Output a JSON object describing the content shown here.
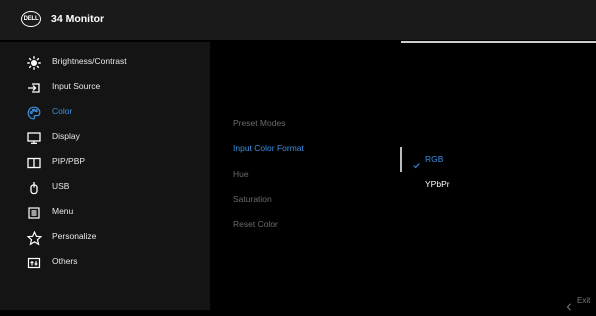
{
  "header": {
    "logo_text": "DELL",
    "title": "34 Monitor"
  },
  "menu": {
    "items": [
      {
        "label": "Brightness/Contrast",
        "icon": "brightness-icon"
      },
      {
        "label": "Input Source",
        "icon": "input-source-icon"
      },
      {
        "label": "Color",
        "icon": "color-palette-icon",
        "active": true
      },
      {
        "label": "Display",
        "icon": "display-icon"
      },
      {
        "label": "PIP/PBP",
        "icon": "pip-pbp-icon"
      },
      {
        "label": "USB",
        "icon": "usb-icon"
      },
      {
        "label": "Menu",
        "icon": "menu-icon"
      },
      {
        "label": "Personalize",
        "icon": "star-icon"
      },
      {
        "label": "Others",
        "icon": "others-icon"
      }
    ]
  },
  "submenu": {
    "items": [
      {
        "label": "Preset Modes"
      },
      {
        "label": "Input Color Format",
        "active": true
      },
      {
        "label": "Hue"
      },
      {
        "label": "Saturation"
      },
      {
        "label": "Reset Color"
      }
    ]
  },
  "options": {
    "items": [
      {
        "label": "RGB",
        "selected": true
      },
      {
        "label": "YPbPr"
      }
    ]
  },
  "footer": {
    "exit_label": "Exit"
  },
  "colors": {
    "accent": "#3b8fe0",
    "header_bg": "#1a1a1a",
    "panel_bg": "#141414",
    "inactive_text": "#6b6b6b"
  }
}
